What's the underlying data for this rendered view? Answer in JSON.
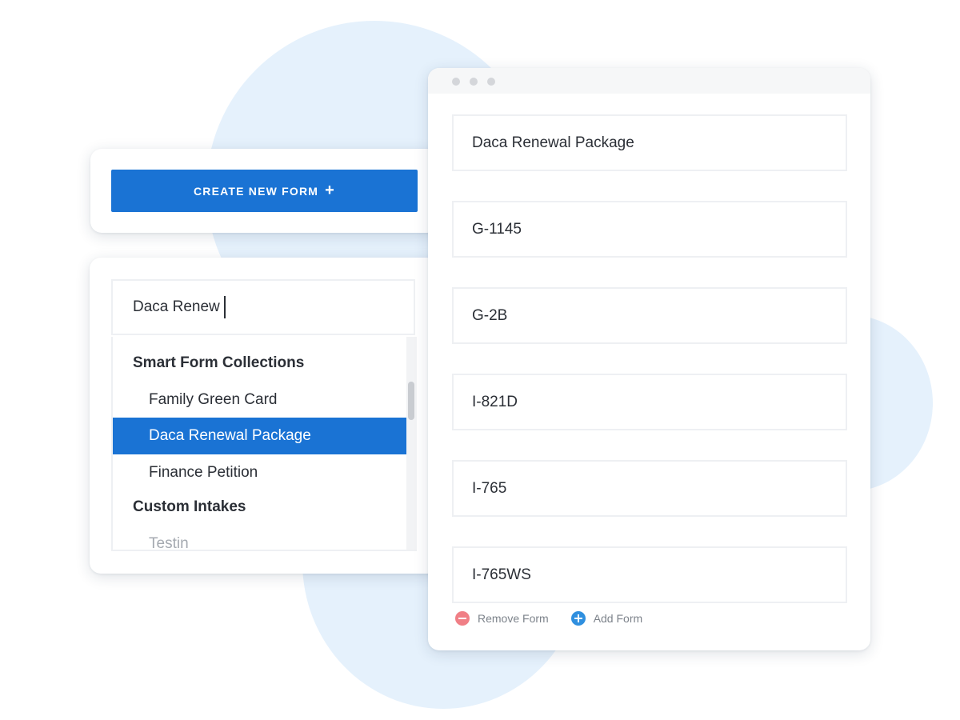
{
  "create_panel": {
    "button_label": "CREATE NEW FORM",
    "button_icon": "plus-icon"
  },
  "search_panel": {
    "query": "Daca Renew",
    "groups": [
      {
        "heading": "Smart Form Collections",
        "items": [
          "Family Green Card",
          "Daca Renewal Package",
          "Finance Petition"
        ]
      },
      {
        "heading": "Custom Intakes",
        "items": [
          "Testin"
        ]
      }
    ],
    "selected_item": "Daca Renewal Package"
  },
  "forms_window": {
    "forms": [
      "Daca Renewal Package",
      "G-1145",
      "G-2B",
      "I-821D",
      "I-765",
      "I-765WS"
    ],
    "remove_label": "Remove Form",
    "add_label": "Add Form",
    "remove_icon": "minus-circle-icon",
    "add_icon": "plus-circle-icon"
  },
  "colors": {
    "accent": "#1a73d4",
    "background_blob": "#e5f1fc",
    "remove": "#f07f86",
    "add": "#2f8fdf"
  }
}
